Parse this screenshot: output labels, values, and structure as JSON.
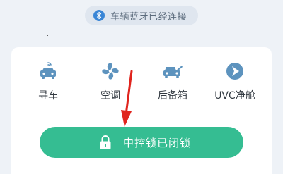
{
  "status_bar": {
    "text": "车辆蓝牙已经连接",
    "icon": "bluetooth-icon"
  },
  "features": [
    {
      "label": "寻车",
      "icon": "car-icon"
    },
    {
      "label": "空调",
      "icon": "fan-icon"
    },
    {
      "label": "后备箱",
      "icon": "car-trunk-icon"
    },
    {
      "label": "UVC净舱",
      "icon": "uvc-icon"
    }
  ],
  "lock_button": {
    "label": "中控锁已闭锁",
    "icon": "lock-icon"
  },
  "colors": {
    "accent": "#35bd92",
    "icon": "#5d93be",
    "annotation_arrow": "#e0241d",
    "background": "#eef2f7"
  }
}
